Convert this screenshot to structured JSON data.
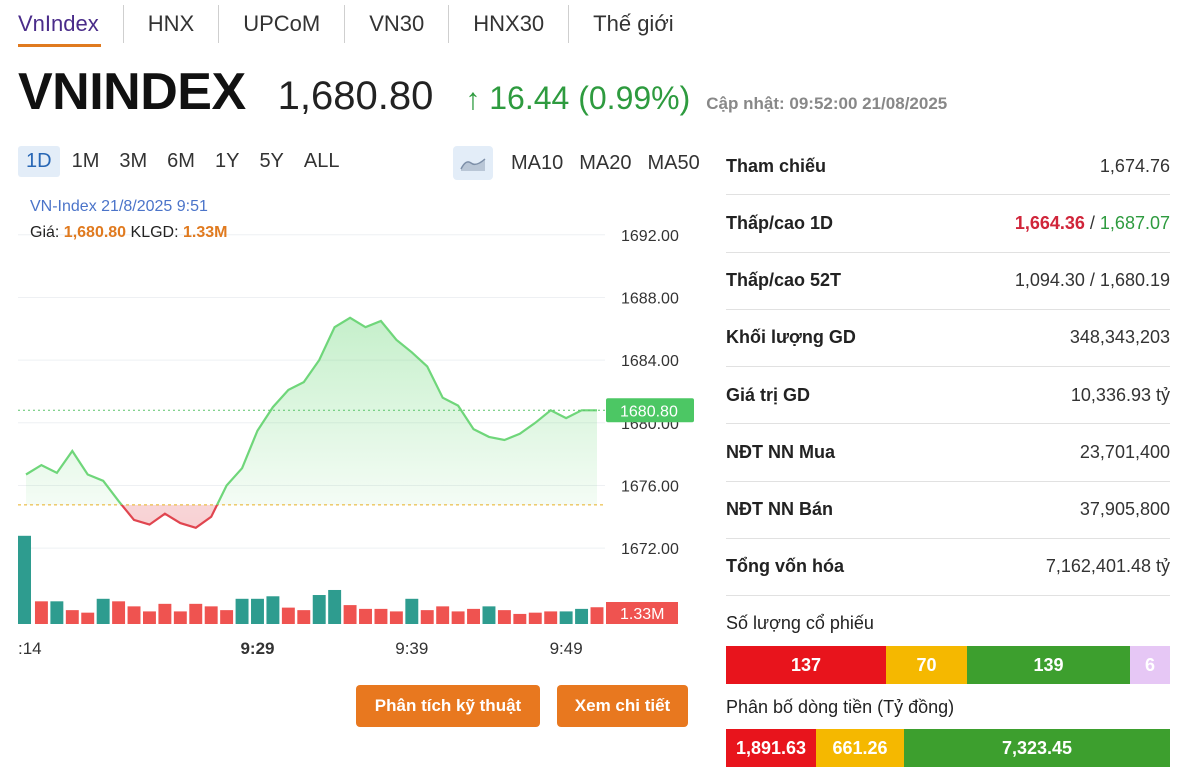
{
  "tabs": [
    "VnIndex",
    "HNX",
    "UPCoM",
    "VN30",
    "HNX30",
    "Thế giới"
  ],
  "header": {
    "name": "VNINDEX",
    "price": "1,680.80",
    "change": "16.44",
    "change_pct": "(0.99%)",
    "update": "Cập nhật: 09:52:00 21/08/2025"
  },
  "ranges": [
    "1D",
    "1M",
    "3M",
    "6M",
    "1Y",
    "5Y",
    "ALL"
  ],
  "ma": [
    "MA10",
    "MA20",
    "MA50"
  ],
  "tooltip": {
    "title": "VN-Index 21/8/2025 9:51",
    "price_label": "Giá:",
    "price": "1,680.80",
    "vol_label": "KLGD:",
    "vol": "1.33M"
  },
  "chart_data": {
    "type": "line",
    "yticks": [
      "1692.00",
      "1688.00",
      "1684.00",
      "1680.00",
      "1676.00",
      "1672.00"
    ],
    "ylim": [
      1668.18,
      1694.22
    ],
    "x_ticks": [
      {
        "label": ":14",
        "index": 0,
        "bold": false
      },
      {
        "label": "9:29",
        "index": 15,
        "bold": true
      },
      {
        "label": "9:39",
        "index": 25,
        "bold": false
      },
      {
        "label": "9:49",
        "index": 35,
        "bold": false
      }
    ],
    "reference": 1674.76,
    "last_price_label": "1680.80",
    "last_price": 1680.8,
    "volume_label": "1.33M",
    "prices": [
      1676.7,
      1677.3,
      1676.8,
      1678.2,
      1676.7,
      1676.3,
      1675.0,
      1673.8,
      1673.5,
      1674.2,
      1673.6,
      1673.3,
      1674.0,
      1676.0,
      1677.1,
      1679.5,
      1681.0,
      1682.1,
      1682.6,
      1684.0,
      1686.1,
      1686.7,
      1686.1,
      1686.5,
      1685.3,
      1684.5,
      1683.6,
      1681.6,
      1681.1,
      1679.6,
      1679.1,
      1678.9,
      1679.3,
      1680.0,
      1680.8,
      1680.3,
      1680.8,
      1680.8
    ],
    "volumes": [
      7.0,
      1.8,
      1.8,
      1.1,
      0.9,
      2.0,
      1.8,
      1.4,
      1.0,
      1.6,
      1.0,
      1.6,
      1.4,
      1.1,
      2.0,
      2.0,
      2.2,
      1.3,
      1.1,
      2.3,
      2.7,
      1.5,
      1.2,
      1.2,
      1.0,
      2.0,
      1.1,
      1.4,
      1.0,
      1.2,
      1.4,
      1.1,
      0.8,
      0.9,
      1.0,
      1.0,
      1.2,
      1.33
    ],
    "volume_up": [
      true,
      false,
      true,
      false,
      false,
      true,
      false,
      false,
      false,
      false,
      false,
      false,
      false,
      false,
      true,
      true,
      true,
      false,
      false,
      true,
      true,
      false,
      false,
      false,
      false,
      true,
      false,
      false,
      false,
      false,
      true,
      false,
      false,
      false,
      false,
      true,
      true,
      false
    ]
  },
  "buttons": {
    "technical": "Phân tích kỹ thuật",
    "detail": "Xem chi tiết"
  },
  "stats": {
    "tham_chieu": {
      "label": "Tham chiếu",
      "value": "1,674.76"
    },
    "thap_cao_1d": {
      "label": "Thấp/cao 1D",
      "low": "1,664.36",
      "sep": " / ",
      "high": "1,687.07"
    },
    "thap_cao_52t": {
      "label": "Thấp/cao 52T",
      "value": "1,094.30 / 1,680.19"
    },
    "khoi_luong": {
      "label": "Khối lượng GD",
      "value": "348,343,203"
    },
    "gia_tri": {
      "label": "Giá trị GD",
      "value": "10,336.93 tỷ"
    },
    "ndt_mua": {
      "label": "NĐT NN Mua",
      "value": "23,701,400"
    },
    "ndt_ban": {
      "label": "NĐT NN Bán",
      "value": "37,905,800"
    },
    "von_hoa": {
      "label": "Tổng vốn hóa",
      "value": "7,162,401.48 tỷ"
    }
  },
  "stock_count": {
    "title": "Số lượng cổ phiếu",
    "segments": [
      {
        "value": "137",
        "color": "#e8141c"
      },
      {
        "value": "70",
        "color": "#f5b800"
      },
      {
        "value": "139",
        "color": "#3d9f2e"
      },
      {
        "value": "6",
        "color": "#e6c7f5"
      }
    ]
  },
  "money_flow": {
    "title": "Phân bố dòng tiền (Tỷ đồng)",
    "segments": [
      {
        "value": "1,891.63",
        "color": "#e8141c"
      },
      {
        "value": "661.26",
        "color": "#f5b800"
      },
      {
        "value": "7,323.45",
        "color": "#3d9f2e"
      }
    ]
  }
}
